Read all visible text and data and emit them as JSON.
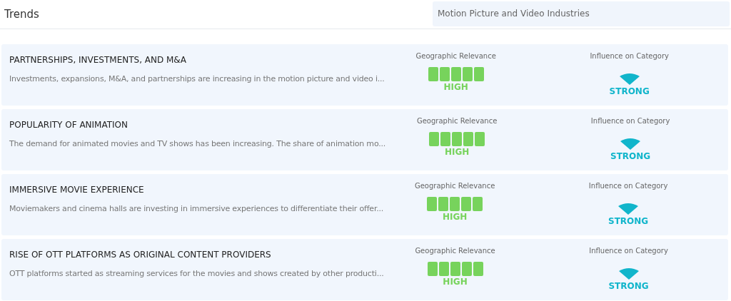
{
  "header": {
    "title": "Trends",
    "search": {
      "value": "Motion Picture and Video Industries"
    }
  },
  "trends": [
    {
      "title": "PARTNERSHIPS, INVESTMENTS, AND M&A",
      "summary": "Investments, expansions, M&A, and partnerships are increasing in the motion picture and video i...",
      "relevance": {
        "label": "Geographic Relevance",
        "level": 1,
        "reading": "HIGH"
      },
      "influence": {
        "label": "Influence on Category",
        "reading": "STRONG"
      }
    },
    {
      "title": "POPULARITY OF ANIMATION",
      "summary": "The demand for animated movies and TV shows has been increasing. The share of animation mo...",
      "relevance": {
        "label": "Geographic Relevance",
        "level": 1,
        "reading": "HIGH"
      },
      "influence": {
        "label": "Influence on Category",
        "reading": "STRONG"
      }
    },
    {
      "title": "IMMERSIVE MOVIE EXPERIENCE",
      "summary": "Moviemakers and cinema halls are investing in immersive experiences to differentiate their offer...",
      "relevance": {
        "label": "Geographic Relevance",
        "level": 1,
        "reading": "HIGH"
      },
      "influence": {
        "label": "Influence on Category",
        "reading": "STRONG"
      }
    },
    {
      "title": "RISE OF OTT PLATFORMS AS ORIGINAL CONTENT PROVIDERS",
      "summary": "OTT platforms started as streaming services for the movies and shows created by other producti...",
      "relevance": {
        "label": "Geographic Relevance",
        "level": 1,
        "reading": "HIGH"
      },
      "influence": {
        "label": "Influence on Category",
        "reading": "STRONG"
      }
    }
  ]
}
